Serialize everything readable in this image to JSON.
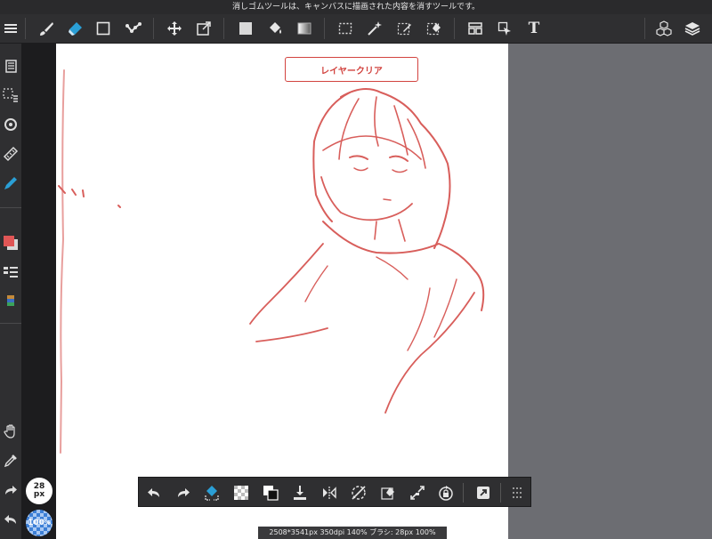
{
  "hint_bar": {
    "text": "消しゴムツールは、キャンバスに描画された内容を消すツールです。"
  },
  "toolbar": {
    "items": [
      {
        "name": "menu-icon"
      },
      {
        "name": "brush-icon"
      },
      {
        "name": "eraser-icon"
      },
      {
        "name": "rectangle-icon"
      },
      {
        "name": "dot-line-icon"
      },
      {
        "name": "move-icon"
      },
      {
        "name": "transform-icon"
      },
      {
        "name": "fill-color-icon"
      },
      {
        "name": "bucket-icon"
      },
      {
        "name": "gradient-icon"
      },
      {
        "name": "select-rect-icon"
      },
      {
        "name": "magic-wand-icon"
      },
      {
        "name": "select-pen-icon"
      },
      {
        "name": "select-eraser-icon"
      },
      {
        "name": "panel-icon"
      },
      {
        "name": "select-arrow-icon"
      },
      {
        "name": "text-icon"
      },
      {
        "name": "3d-cubes-icon"
      },
      {
        "name": "layers-icon"
      }
    ],
    "text_tool_label": "T"
  },
  "canvas": {
    "clear_layer_label": "レイヤークリア",
    "stroke_color": "#d2433f"
  },
  "sidebar": {
    "brush_size": {
      "value": "28",
      "unit": "px"
    },
    "opacity": {
      "value": "100",
      "unit": "%"
    }
  },
  "bottom_bar": {
    "items": [
      "undo-icon",
      "redo-icon",
      "clear-layer-icon",
      "transparent-icon",
      "color-swap-icon",
      "download-icon",
      "flip-icon",
      "rotate-reset-icon",
      "erase-selection-icon",
      "zoom-fit-icon",
      "rotate-lock-icon",
      "expand-icon",
      "grip-icon"
    ]
  },
  "status": {
    "text": "2508*3541px 350dpi 140% ブラシ: 28px 100%"
  },
  "colors": {
    "accent": "#2a9fd6",
    "toolbar_bg": "#2f2f31",
    "gutter_bg": "#6c6d72"
  }
}
